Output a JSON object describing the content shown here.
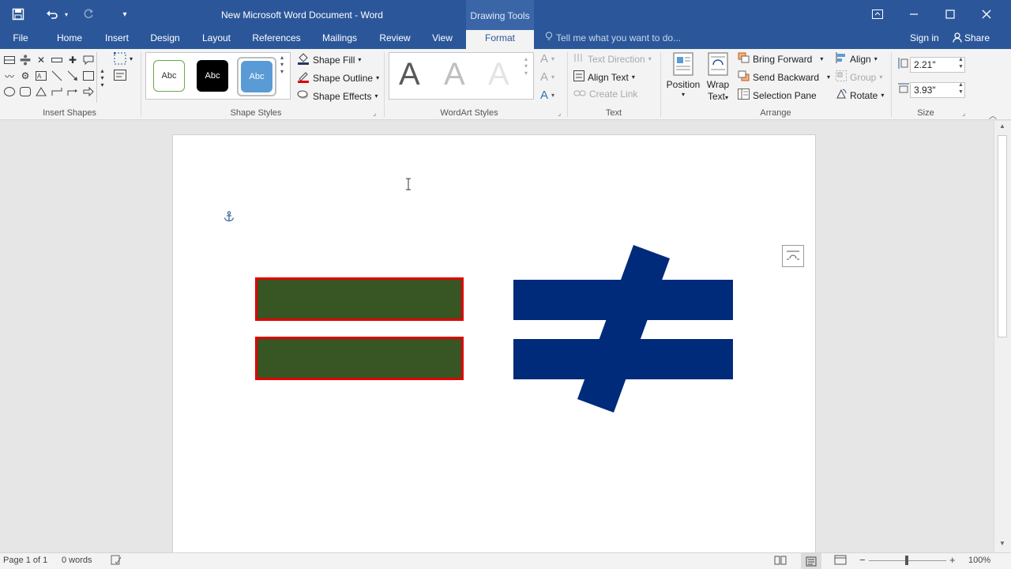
{
  "window": {
    "title": "New Microsoft Word Document - Word",
    "contextual_tab_group": "Drawing Tools",
    "controls": {
      "restore_ribbon": "⧉",
      "minimize": "—",
      "maximize": "☐",
      "close": "✕"
    }
  },
  "quick_access": {
    "save": "save-icon",
    "undo": "undo-icon",
    "redo": "redo-icon",
    "customize": "customize-icon"
  },
  "tabs": [
    "File",
    "Home",
    "Insert",
    "Design",
    "Layout",
    "References",
    "Mailings",
    "Review",
    "View",
    "Format"
  ],
  "active_tab": "Format",
  "tell_me": {
    "placeholder": "Tell me what you want to do..."
  },
  "account": {
    "sign_in": "Sign in",
    "share": "Share"
  },
  "ribbon": {
    "insert_shapes": {
      "label": "Insert Shapes"
    },
    "shape_styles": {
      "label": "Shape Styles",
      "presets": [
        "Abc",
        "Abc",
        "Abc"
      ],
      "fill": "Shape Fill",
      "outline": "Shape Outline",
      "effects": "Shape Effects"
    },
    "wordart_styles": {
      "label": "WordArt Styles",
      "letters": [
        "A",
        "A",
        "A"
      ]
    },
    "text": {
      "label": "Text",
      "direction": "Text Direction",
      "align": "Align Text",
      "link": "Create Link"
    },
    "arrange": {
      "label": "Arrange",
      "position": "Position",
      "wrap_line1": "Wrap",
      "wrap_line2": "Text",
      "bring_forward": "Bring Forward",
      "send_backward": "Send Backward",
      "selection_pane": "Selection Pane",
      "align": "Align",
      "group": "Group",
      "rotate": "Rotate"
    },
    "size": {
      "label": "Size",
      "height": "2.21\"",
      "width": "3.93\""
    }
  },
  "colors": {
    "brand": "#2b579a",
    "equals_fill": "#375623",
    "equals_outline": "#e00000",
    "not_equal_fill": "#002a7a"
  },
  "status": {
    "page": "Page 1 of 1",
    "words": "0 words",
    "zoom": "100%"
  }
}
